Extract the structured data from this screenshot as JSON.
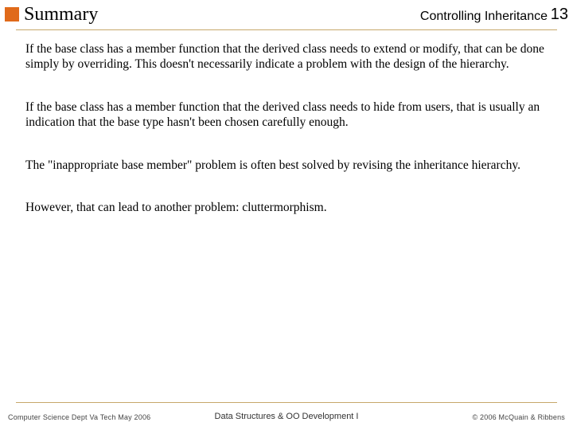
{
  "header": {
    "title": "Summary",
    "topic": "Controlling Inheritance",
    "page_number": "13"
  },
  "body": {
    "paragraphs": [
      "If the base class has a member function that the derived class needs to extend or modify, that can be done simply by overriding.  This doesn't necessarily indicate a problem with the design of the hierarchy.",
      "If the base class has a member function that the derived class needs to hide from users, that is usually an indication that the base type hasn't been chosen carefully enough.",
      "The \"inappropriate base member\" problem is often best solved by revising the inheritance hierarchy.",
      "However, that can lead to another problem:  cluttermorphism."
    ]
  },
  "footer": {
    "left": "Computer Science Dept Va Tech May 2006",
    "center": "Data Structures & OO Development I",
    "right": "© 2006  McQuain & Ribbens"
  }
}
